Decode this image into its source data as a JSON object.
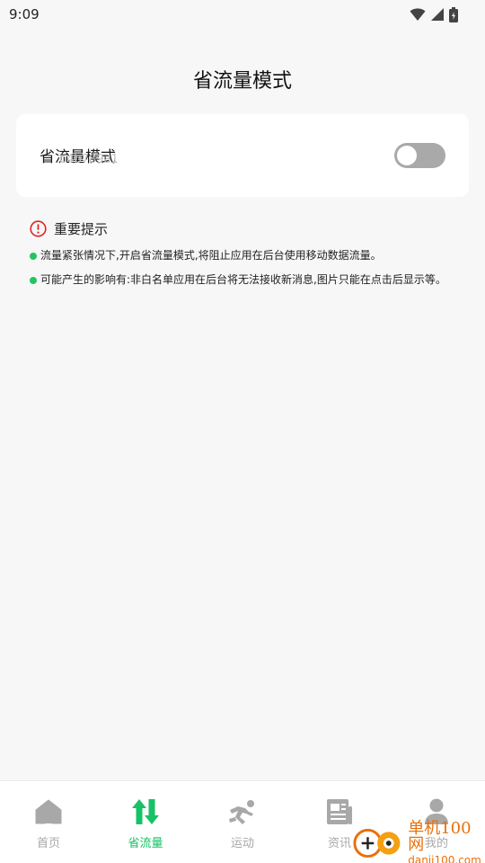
{
  "status": {
    "time": "9:09"
  },
  "header": {
    "title": "省流量模式"
  },
  "setting": {
    "label": "省流量模式",
    "sublabel": "b4b789a1",
    "enabled": false
  },
  "notice": {
    "title": "重要提示",
    "items": [
      "流量紧张情况下,开启省流量模式,将阻止应用在后台使用移动数据流量。",
      "可能产生的影响有:非白名单应用在后台将无法接收新消息,图片只能在点击后显示等。"
    ]
  },
  "tabs": [
    {
      "label": "首页",
      "icon": "home-icon",
      "active": false
    },
    {
      "label": "省流量",
      "icon": "data-transfer-icon",
      "active": true
    },
    {
      "label": "运动",
      "icon": "running-icon",
      "active": false
    },
    {
      "label": "资讯",
      "icon": "news-icon",
      "active": false
    },
    {
      "label": "我的",
      "icon": "profile-icon",
      "active": false
    }
  ],
  "watermark": {
    "title": "单机100网",
    "url": "danji100.com"
  },
  "colors": {
    "accent": "#16c265",
    "warning": "#e02424",
    "toggle_off": "#a9a9a9",
    "background": "#f7f7f7"
  }
}
